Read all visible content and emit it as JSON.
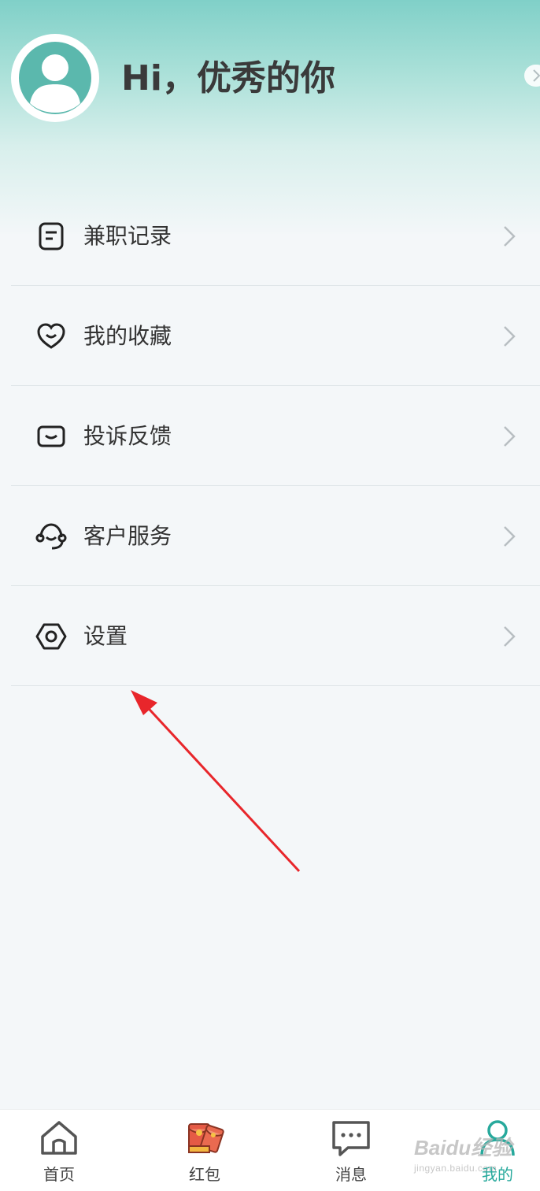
{
  "profile": {
    "greeting": "Hi，优秀的你",
    "avatar_icon": "user-avatar-icon"
  },
  "menu": [
    {
      "label": "兼职记录",
      "icon": "document-icon"
    },
    {
      "label": "我的收藏",
      "icon": "heart-icon"
    },
    {
      "label": "投诉反馈",
      "icon": "feedback-icon"
    },
    {
      "label": "客户服务",
      "icon": "headset-icon"
    },
    {
      "label": "设置",
      "icon": "settings-icon"
    }
  ],
  "tabbar": [
    {
      "label": "首页",
      "icon": "home-icon",
      "active": false
    },
    {
      "label": "红包",
      "icon": "red-envelope-icon",
      "active": false
    },
    {
      "label": "消息",
      "icon": "message-icon",
      "active": false
    },
    {
      "label": "我的",
      "icon": "user-icon",
      "active": true
    }
  ],
  "watermark": {
    "line1": "Baidu经验",
    "line2": "jingyan.baidu.com"
  },
  "colors": {
    "accent": "#27a99c",
    "annotation_arrow": "#e8262b",
    "header_top": "#80d0c8"
  }
}
